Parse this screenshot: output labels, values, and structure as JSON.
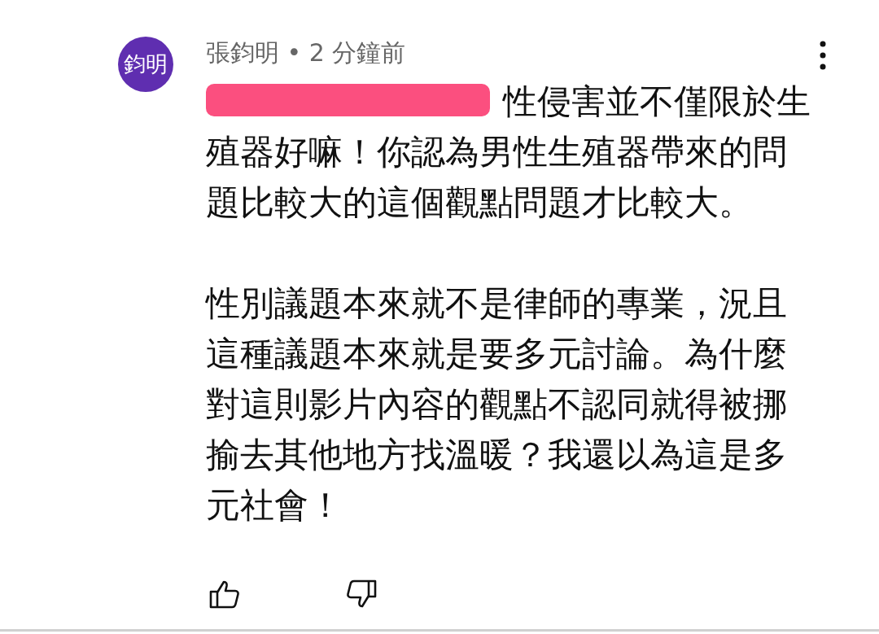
{
  "comment": {
    "avatar": "鈞明",
    "header": "張鈞明 • 2 分鐘前",
    "mention_redacted": true,
    "paragraphs": [
      "性侵害並不僅限於生殖器好嘛！你認為男性生殖器帶來的問題比較大的這個觀點問題才比較大。",
      "性別議題本來就不是律師的專業，況且這種議題本來就是要多元討論。為什麼對這則影片內容的觀點不認同就得被挪揄去其他地方找溫暖？我還以為這是多元社會！"
    ]
  }
}
